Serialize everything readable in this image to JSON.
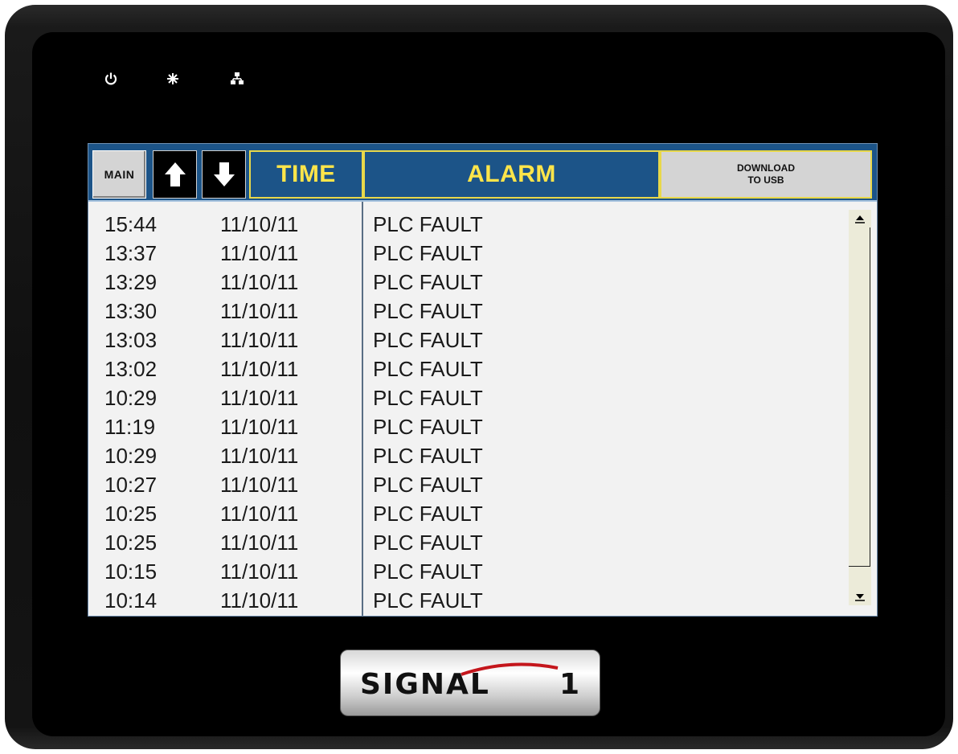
{
  "indicators": [
    {
      "name": "power-icon"
    },
    {
      "name": "activity-star-icon"
    },
    {
      "name": "network-icon"
    }
  ],
  "header": {
    "main_label": "MAIN",
    "time_label": "TIME",
    "alarm_label": "ALARM",
    "usb_label_line1": "DOWNLOAD",
    "usb_label_line2": "TO USB",
    "up_icon": "arrow-up-icon",
    "down_icon": "arrow-down-icon"
  },
  "alarms": [
    {
      "time": "15:44",
      "date": "11/10/11",
      "alarm": "PLC FAULT"
    },
    {
      "time": "13:37",
      "date": "11/10/11",
      "alarm": "PLC FAULT"
    },
    {
      "time": "13:29",
      "date": "11/10/11",
      "alarm": "PLC FAULT"
    },
    {
      "time": "13:30",
      "date": "11/10/11",
      "alarm": "PLC FAULT"
    },
    {
      "time": "13:03",
      "date": "11/10/11",
      "alarm": "PLC FAULT"
    },
    {
      "time": "13:02",
      "date": "11/10/11",
      "alarm": "PLC FAULT"
    },
    {
      "time": "10:29",
      "date": "11/10/11",
      "alarm": "PLC FAULT"
    },
    {
      "time": "11:19",
      "date": "11/10/11",
      "alarm": "PLC FAULT"
    },
    {
      "time": "10:29",
      "date": "11/10/11",
      "alarm": "PLC FAULT"
    },
    {
      "time": "10:27",
      "date": "11/10/11",
      "alarm": "PLC FAULT"
    },
    {
      "time": "10:25",
      "date": "11/10/11",
      "alarm": "PLC FAULT"
    },
    {
      "time": "10:25",
      "date": "11/10/11",
      "alarm": "PLC FAULT"
    },
    {
      "time": "10:15",
      "date": "11/10/11",
      "alarm": "PLC FAULT"
    },
    {
      "time": "10:14",
      "date": "11/10/11",
      "alarm": "PLC FAULT"
    }
  ],
  "brand": {
    "name": "SIGNAL",
    "number": "1"
  },
  "colors": {
    "header_bg": "#1c5488",
    "header_text": "#ffe54a",
    "header_border": "#e8d84a",
    "list_bg": "#f2f2f2"
  }
}
